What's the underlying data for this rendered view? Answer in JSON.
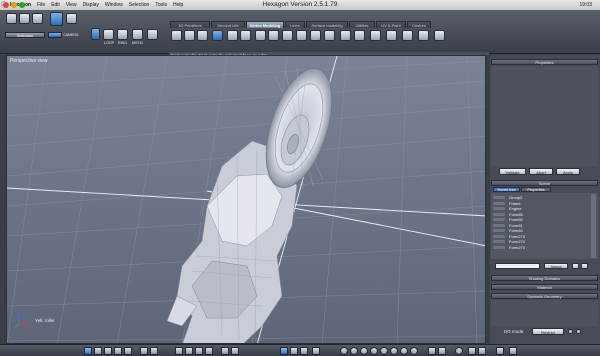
{
  "menubar": {
    "apple": "",
    "items": [
      "Hexagon",
      "File",
      "Edit",
      "View",
      "Display",
      "Window",
      "Selection",
      "Tools",
      "Help"
    ],
    "clock": "19:03"
  },
  "window": {
    "title": "Hexagon Version 2.5.1.79"
  },
  "toolbar": {
    "selection_label": "Selection",
    "camera_label": "CAMERA",
    "tabs": [
      "3D Primitives",
      "Second Life",
      "Vertex Modeling",
      "Lines",
      "Surface modeling",
      "Utilities",
      "UV & Paint",
      "Custom"
    ],
    "active_tab_index": 2,
    "mode_buttons": [
      "LOOP",
      "RING",
      "MSTM"
    ],
    "hint": "Fast extrude: Fast extrude selected face or edge"
  },
  "viewport": {
    "label": "Perspective view",
    "axis_label": "Yell. roller"
  },
  "properties_panel": {
    "title": "Properties",
    "buttons": [
      "Validate",
      "Abort",
      "Apply"
    ]
  },
  "scene_panel": {
    "title": "Scene",
    "tabs": [
      "Scene tree",
      "Properties"
    ],
    "items": [
      "Group2",
      "Frame",
      "Engine",
      "Form65",
      "Form50",
      "Form61",
      "Form64",
      "Form270",
      "Form270",
      "Form270"
    ],
    "select_label": "Select"
  },
  "collapsed_panels": [
    "Shading Domains",
    "Material",
    "Dynamic Geometry"
  ],
  "dg_mode": {
    "label": "DG mode:",
    "value": "Restrict"
  },
  "colors": {
    "viewport_bg": "#6c7488",
    "panel_bg": "#474b55",
    "accent": "#3c78c8"
  }
}
